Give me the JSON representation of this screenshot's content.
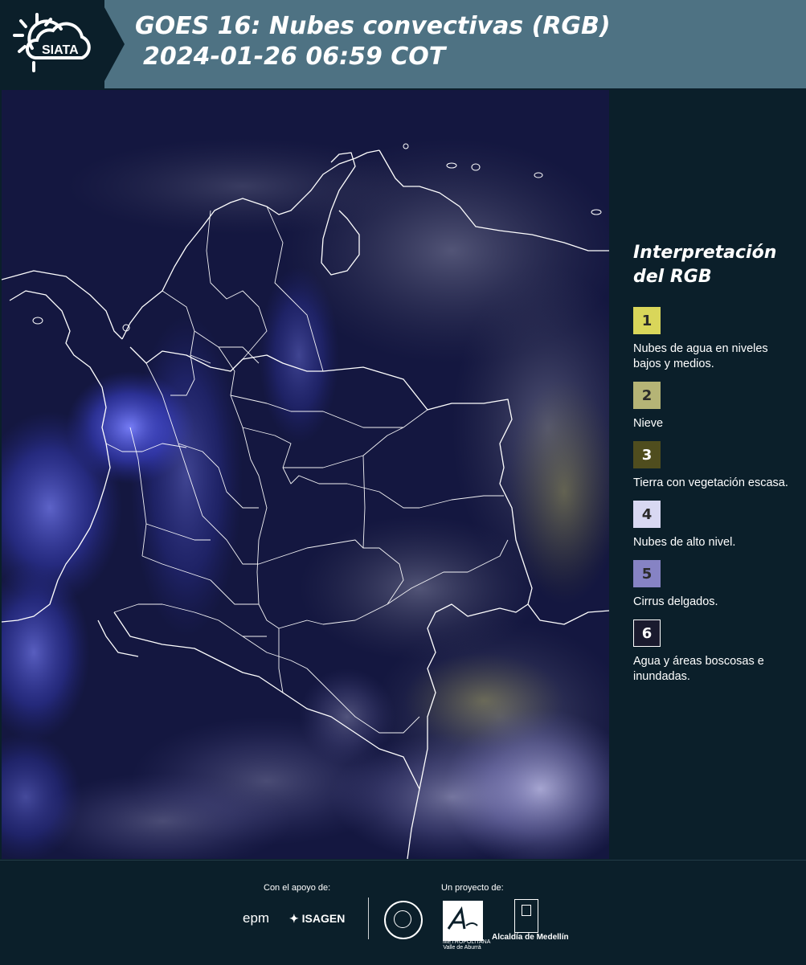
{
  "header": {
    "logo_text": "SIATA",
    "title_line1": "GOES 16: Nubes convectivas (RGB)",
    "title_line2": "2024-01-26 06:59 COT",
    "background_color": "#4e7283"
  },
  "map": {
    "background_color": "#13163d",
    "border_color": "#ffffff"
  },
  "legend": {
    "title_line1": "Interpretación",
    "title_line2": "del RGB",
    "items": [
      {
        "number": "1",
        "color": "#d9d65a",
        "label": "Nubes de agua en niveles bajos y medios."
      },
      {
        "number": "2",
        "color": "#b5b476",
        "label": "Nieve"
      },
      {
        "number": "3",
        "color": "#4f4d1e",
        "label": "Tierra con vegetación escasa."
      },
      {
        "number": "4",
        "color": "#d8d8f2",
        "label": "Nubes de alto nivel."
      },
      {
        "number": "5",
        "color": "#8683c4",
        "label": "Cirrus delgados."
      },
      {
        "number": "6",
        "color": "#1a1a2e",
        "label": "Agua y áreas boscosas e inundadas."
      }
    ]
  },
  "footer": {
    "support_label": "Con el apoyo de:",
    "project_label": "Un proyecto de:",
    "sponsor_epm": "epm",
    "sponsor_isagen": "ISAGEN",
    "area_logo_text": "METROPOLITANA Valle de Aburrá",
    "alcaldia_text": "Alcaldía de Medellín"
  }
}
